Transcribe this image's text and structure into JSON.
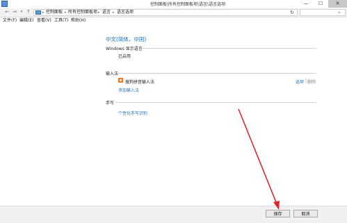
{
  "window": {
    "title": "控制面板\\所有控制面板项\\语言\\语言选项",
    "min_icon": "minimize-icon",
    "max_icon": "maximize-icon",
    "close_icon": "close-icon",
    "min_glyph": "—",
    "max_glyph": "☐",
    "close_glyph": "✕"
  },
  "nav": {
    "back_glyph": "←",
    "forward_glyph": "→",
    "history_glyph": "▾",
    "up_glyph": "↑",
    "refresh_glyph": "↻",
    "search_glyph": "⌕"
  },
  "breadcrumb": [
    "控制面板",
    "所有控制面板项",
    "语言",
    "语言选项"
  ],
  "breadcrumb_sep": "▸",
  "menu": [
    "文件(F)",
    "编辑(E)",
    "查看(V)",
    "工具(T)",
    "帮助(H)"
  ],
  "content": {
    "heading": "中文(简体，中国)",
    "display_language": {
      "label": "Windows 显示语言",
      "status": "已启用"
    },
    "input_method": {
      "label": "输入法",
      "item_name": "搜狗拼音输入法",
      "options_link": "选项",
      "separator": "|",
      "remove_link": "删除",
      "add_link": "添加输入法"
    },
    "handwriting": {
      "label": "手写",
      "personalize_link": "个性化手写识别"
    }
  },
  "buttons": {
    "save": "保存",
    "cancel": "取消"
  },
  "colors": {
    "annotation_arrow": "#e0262b",
    "link": "#1e73be",
    "heading": "#1e6fc0"
  }
}
